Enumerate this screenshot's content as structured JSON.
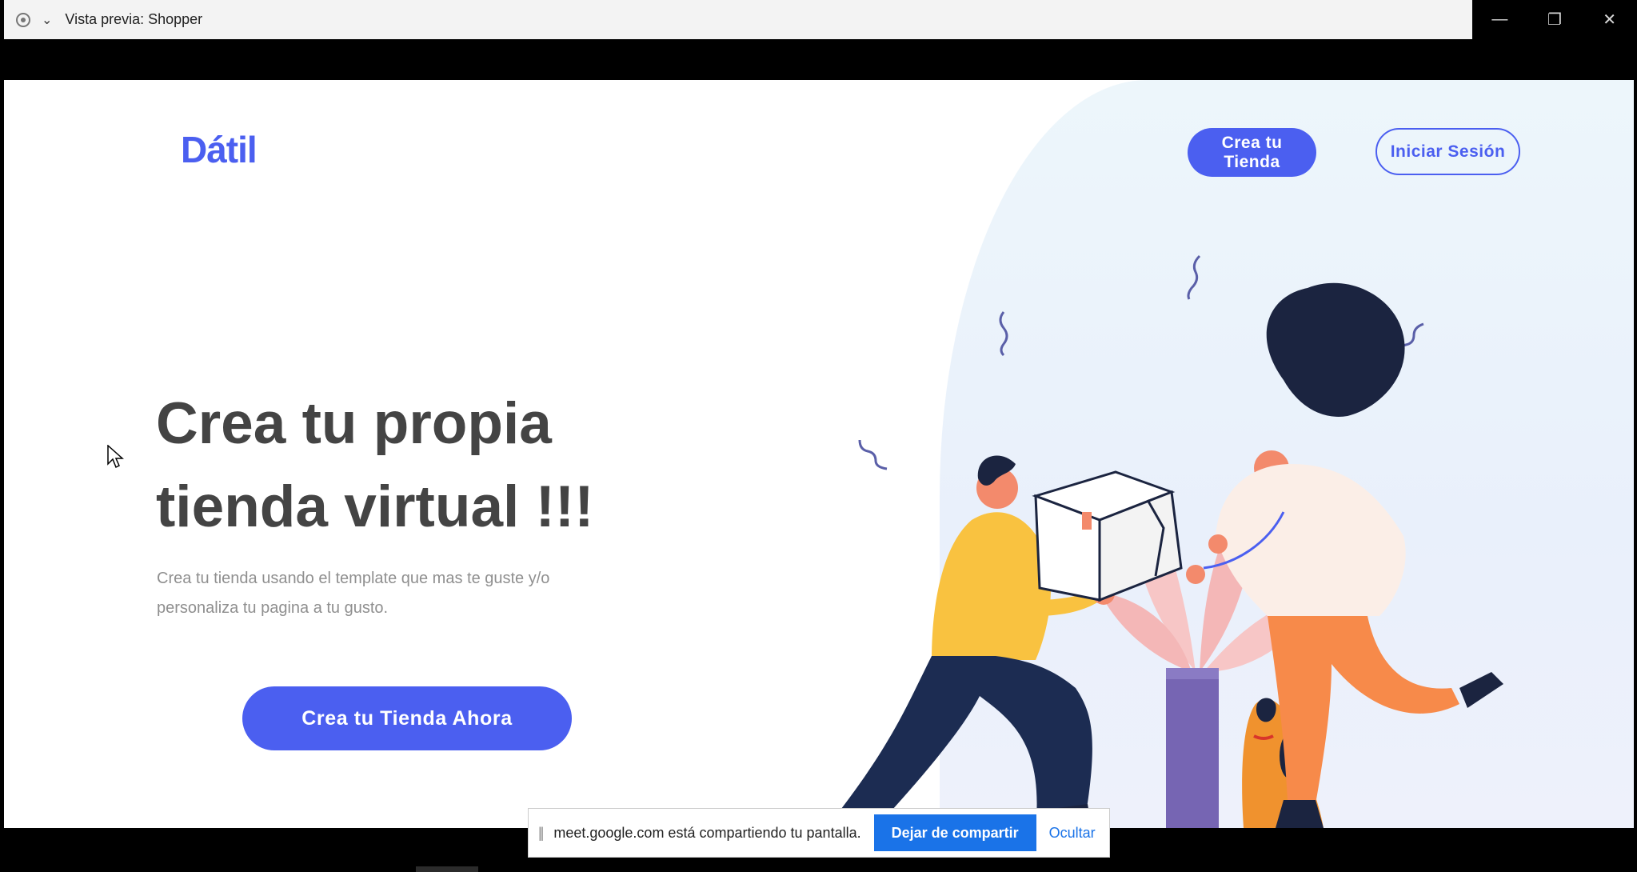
{
  "window": {
    "title": "Vista previa: Shopper",
    "controls": [
      "—",
      "❐",
      "✕"
    ]
  },
  "site": {
    "logo": "Dátil",
    "nav": {
      "primary_button": "Crea tu Tienda",
      "secondary_button": "Iniciar Sesión"
    },
    "hero": {
      "headline_line1": "Crea tu propia",
      "headline_line2": "tienda virtual !!!",
      "subtitle_line1": "Crea tu tienda usando el template que mas te guste y/o",
      "subtitle_line2": "personaliza tu pagina a tu gusto.",
      "cta": "Crea tu Tienda Ahora"
    },
    "colors": {
      "accent": "#4b5ff0",
      "heading": "#444444",
      "subtitle": "#8f8f8f"
    }
  },
  "sharebar": {
    "grip": "||",
    "message": "meet.google.com está compartiendo tu pantalla.",
    "stop_button": "Dejar de compartir",
    "hide_link": "Ocultar"
  }
}
